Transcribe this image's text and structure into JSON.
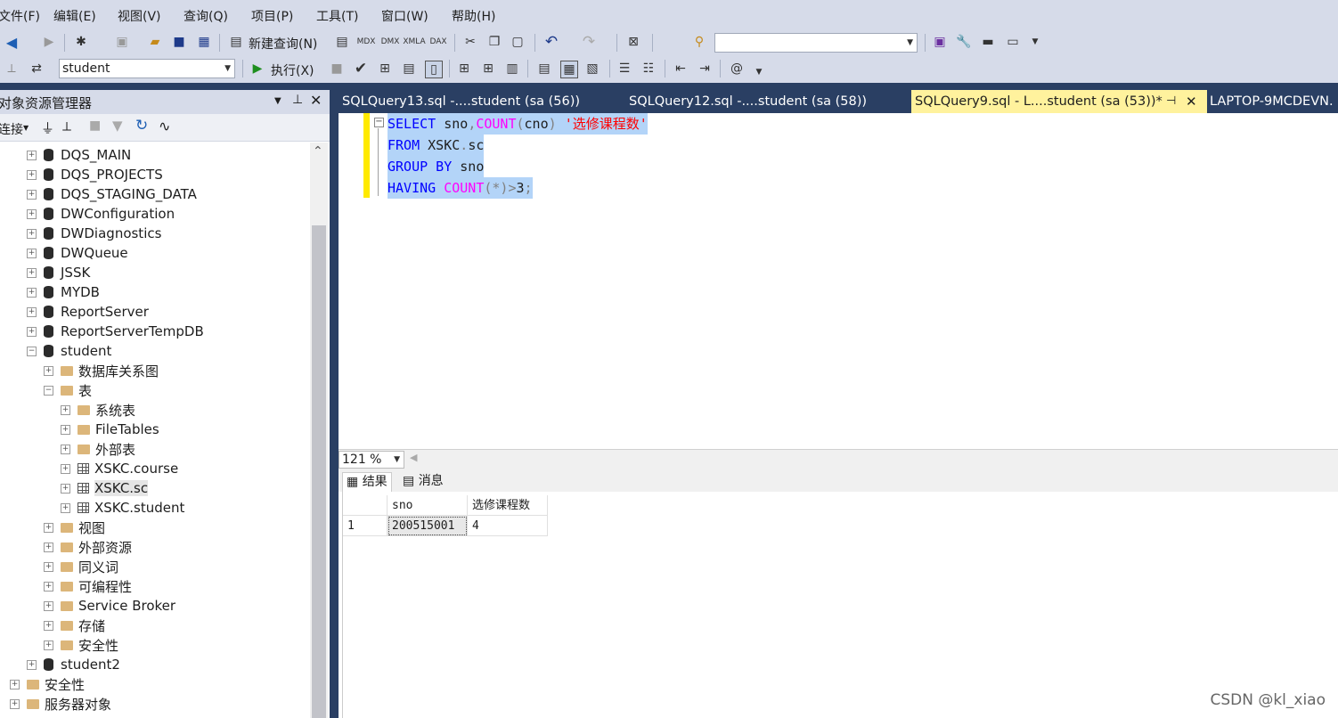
{
  "menu": [
    "文件(F)",
    "编辑(E)",
    "视图(V)",
    "查询(Q)",
    "项目(P)",
    "工具(T)",
    "窗口(W)",
    "帮助(H)"
  ],
  "toolbar": {
    "new_query_label": "新建查询(N)",
    "database_combo_value": "student",
    "execute_label": "执行(X)",
    "search_combo_value": ""
  },
  "object_explorer": {
    "title": "对象资源管理器",
    "connect_label": "连接",
    "tree": [
      {
        "label": "DQS_MAIN",
        "type": "db"
      },
      {
        "label": "DQS_PROJECTS",
        "type": "db"
      },
      {
        "label": "DQS_STAGING_DATA",
        "type": "db"
      },
      {
        "label": "DWConfiguration",
        "type": "db"
      },
      {
        "label": "DWDiagnostics",
        "type": "db"
      },
      {
        "label": "DWQueue",
        "type": "db"
      },
      {
        "label": "JSSK",
        "type": "db"
      },
      {
        "label": "MYDB",
        "type": "db"
      },
      {
        "label": "ReportServer",
        "type": "db"
      },
      {
        "label": "ReportServerTempDB",
        "type": "db"
      },
      {
        "label": "student",
        "type": "db",
        "expanded": true
      },
      {
        "label": "数据库关系图",
        "type": "folder"
      },
      {
        "label": "表",
        "type": "folder",
        "expanded": true
      },
      {
        "label": "系统表",
        "type": "folder"
      },
      {
        "label": "FileTables",
        "type": "folder"
      },
      {
        "label": "外部表",
        "type": "folder"
      },
      {
        "label": "XSKC.course",
        "type": "table"
      },
      {
        "label": "XSKC.sc",
        "type": "table",
        "selected": true
      },
      {
        "label": "XSKC.student",
        "type": "table"
      },
      {
        "label": "视图",
        "type": "folder"
      },
      {
        "label": "外部资源",
        "type": "folder"
      },
      {
        "label": "同义词",
        "type": "folder"
      },
      {
        "label": "可编程性",
        "type": "folder"
      },
      {
        "label": "Service Broker",
        "type": "folder"
      },
      {
        "label": "存储",
        "type": "folder"
      },
      {
        "label": "安全性",
        "type": "folder"
      },
      {
        "label": "student2",
        "type": "db"
      },
      {
        "label": "安全性",
        "type": "folder"
      },
      {
        "label": "服务器对象",
        "type": "folder"
      }
    ]
  },
  "tabs": [
    {
      "label": "SQLQuery13.sql -....student (sa (56))",
      "active": false
    },
    {
      "label": "SQLQuery12.sql -....student (sa (58))",
      "active": false
    },
    {
      "label": "SQLQuery9.sql - L....student (sa (53))*",
      "active": true
    },
    {
      "label": "LAPTOP-9MCDEVN.",
      "active": false
    }
  ],
  "editor": {
    "lines": [
      {
        "parts": [
          [
            "kw",
            "SELECT"
          ],
          [
            "plain",
            " sno"
          ],
          [
            "gray",
            ","
          ],
          [
            "fn",
            "COUNT"
          ],
          [
            "gray",
            "("
          ],
          [
            "plain",
            "cno"
          ],
          [
            "gray",
            ")"
          ],
          [
            "plain",
            " "
          ],
          [
            "str",
            "'选修课程数'"
          ]
        ]
      },
      {
        "parts": [
          [
            "kw",
            "FROM"
          ],
          [
            "plain",
            " XSKC"
          ],
          [
            "gray",
            "."
          ],
          [
            "plain",
            "sc"
          ]
        ]
      },
      {
        "parts": [
          [
            "kw",
            "GROUP BY"
          ],
          [
            "plain",
            " sno"
          ]
        ]
      },
      {
        "parts": [
          [
            "kw",
            "HAVING"
          ],
          [
            "plain",
            " "
          ],
          [
            "fn",
            "COUNT"
          ],
          [
            "gray",
            "(*)>"
          ],
          [
            "plain",
            "3"
          ],
          [
            "gray",
            ";"
          ]
        ]
      }
    ]
  },
  "zoom": "121 %",
  "results": {
    "tab_results": "结果",
    "tab_messages": "消息",
    "columns": [
      "sno",
      "选修课程数"
    ],
    "rows": [
      {
        "num": "1",
        "values": [
          "200515001",
          "4"
        ]
      }
    ]
  },
  "watermark": "CSDN @kl_xiao"
}
